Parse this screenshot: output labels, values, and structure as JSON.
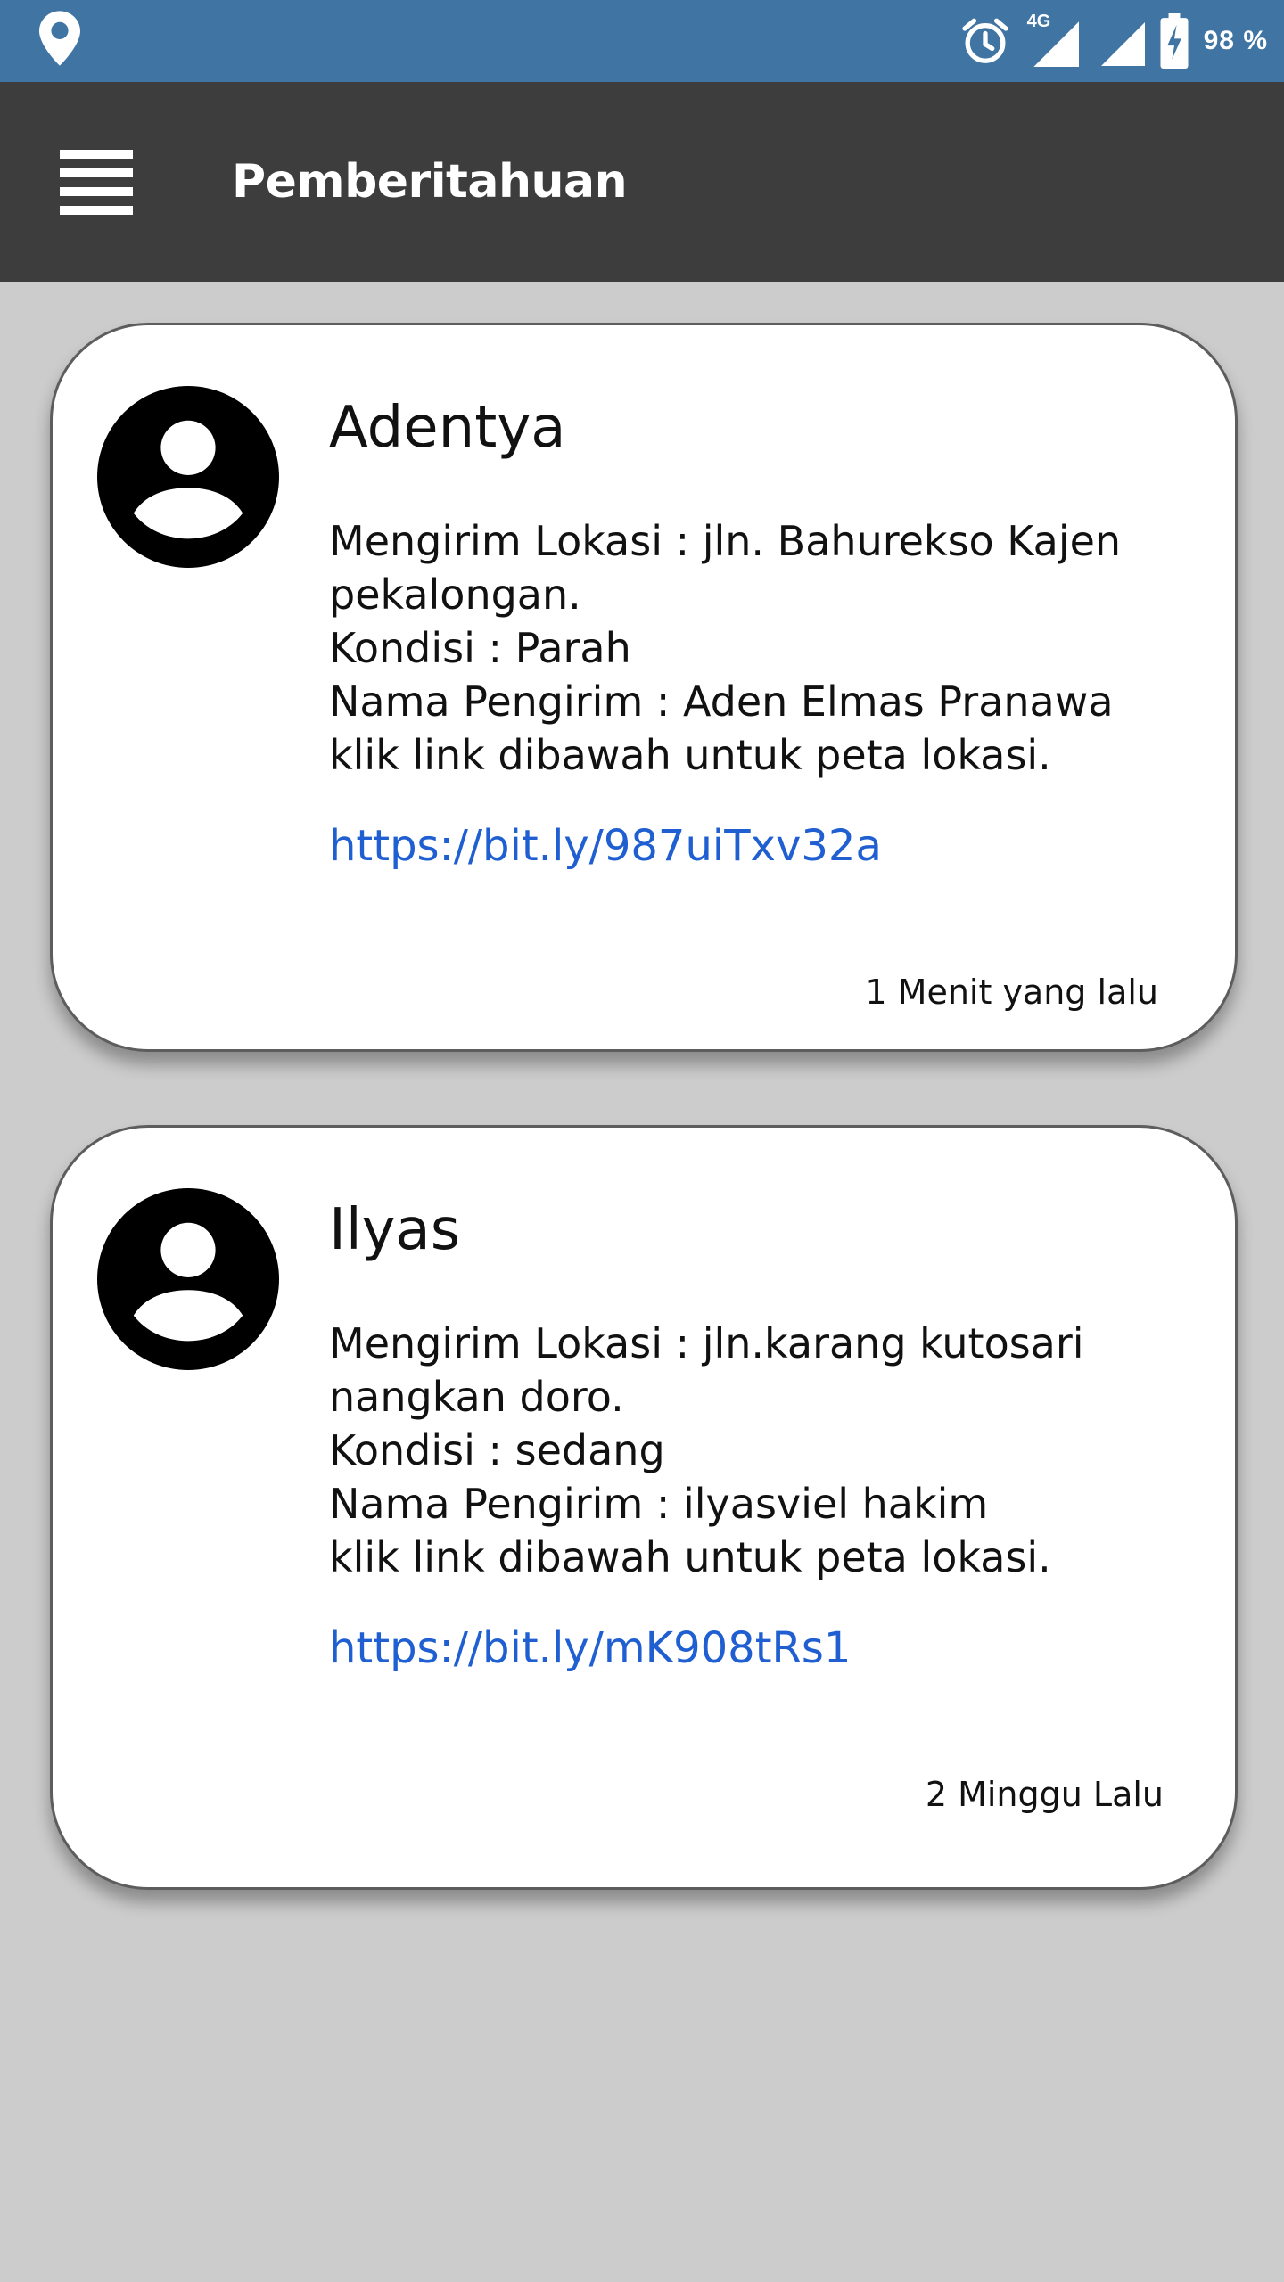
{
  "status_bar": {
    "battery": "98 %",
    "network": "4G",
    "icons": [
      "location-icon",
      "alarm-icon",
      "signal-icon",
      "signal-icon",
      "battery-charging-icon"
    ]
  },
  "app_bar": {
    "title": "Pemberitahuan",
    "menu_icon": "hamburger-menu-icon"
  },
  "notifications": [
    {
      "sender": "Adentya",
      "lines": [
        "Mengirim Lokasi : jln. Bahurekso Kajen",
        "pekalongan.",
        "Kondisi : Parah",
        "Nama Pengirim : Aden Elmas Pranawa",
        "klik link dibawah untuk peta lokasi."
      ],
      "link": "https://bit.ly/987uiTxv32a",
      "time": "1 Menit yang lalu"
    },
    {
      "sender": "Ilyas",
      "lines": [
        "Mengirim Lokasi : jln.karang kutosari",
        "nangkan doro.",
        "Kondisi : sedang",
        "Nama Pengirim : ilyasviel hakim",
        "klik link dibawah untuk peta lokasi."
      ],
      "link": "https://bit.ly/mK908tRs1",
      "time": "2 Minggu Lalu"
    }
  ],
  "colors": {
    "status_bar": "#3f74a3",
    "app_bar": "#3d3d3d",
    "background": "#cccccc",
    "link": "#1f5fd1"
  }
}
